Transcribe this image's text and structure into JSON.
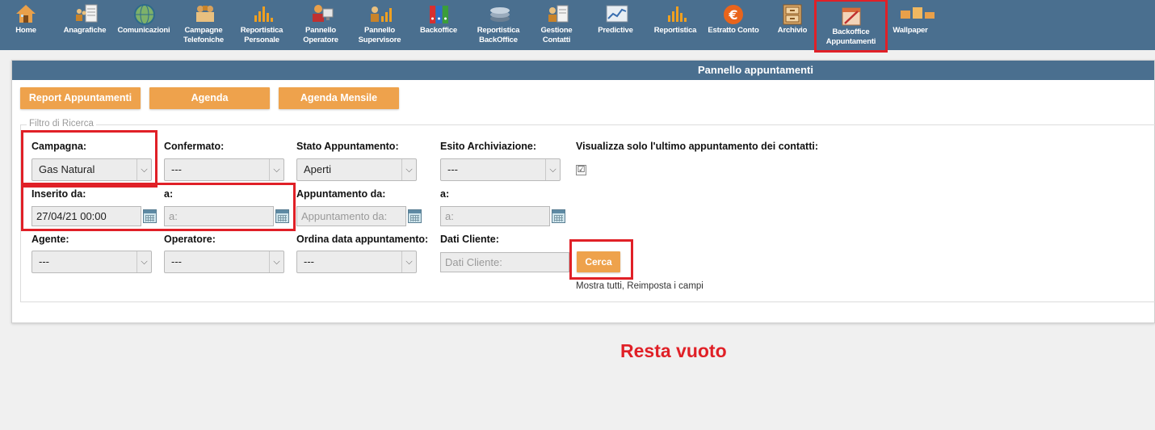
{
  "toolbar": {
    "items": [
      {
        "label": "Home",
        "icon": "home-icon"
      },
      {
        "label": "Anagrafiche",
        "icon": "people-document-icon"
      },
      {
        "label": "Comunicazioni",
        "icon": "globe-icon"
      },
      {
        "label": "Campagne\nTelefoniche",
        "icon": "campaign-icon"
      },
      {
        "label": "Reportistica\nPersonale",
        "icon": "bar-chart-icon"
      },
      {
        "label": "Pannello\nOperatore",
        "icon": "operator-icon"
      },
      {
        "label": "Pannello\nSupervisore",
        "icon": "supervisor-chart-icon"
      },
      {
        "label": "Backoffice",
        "icon": "binders-icon"
      },
      {
        "label": "Reportistica\nBackOffice",
        "icon": "stack-icon"
      },
      {
        "label": "Gestione\nContatti",
        "icon": "contacts-icon"
      },
      {
        "label": "Predictive",
        "icon": "line-chart-icon"
      },
      {
        "label": "Reportistica",
        "icon": "bar-chart-icon"
      },
      {
        "label": "Estratto Conto",
        "icon": "euro-icon"
      },
      {
        "label": "Archivio",
        "icon": "cabinet-icon"
      },
      {
        "label": "Backoffice\nAppuntamenti",
        "icon": "calendar-pencil-icon"
      },
      {
        "label": "Wallpaper",
        "icon": "wallpaper-icon"
      }
    ]
  },
  "panel": {
    "title": "Pannello appuntamenti",
    "buttons": {
      "report": "Report Appuntamenti",
      "agenda": "Agenda",
      "agenda_mensile": "Agenda Mensile"
    },
    "legend": "Filtro di Ricerca"
  },
  "filters": {
    "campagna": {
      "label": "Campagna:",
      "value": "Gas Natural"
    },
    "confermato": {
      "label": "Confermato:",
      "value": "---"
    },
    "stato": {
      "label": "Stato Appuntamento:",
      "value": "Aperti"
    },
    "esito": {
      "label": "Esito Archiviazione:",
      "value": "---"
    },
    "visualizza": {
      "label": "Visualizza solo l'ultimo appuntamento dei contatti:",
      "checked": "☑"
    },
    "inserito_da": {
      "label": "Inserito da:",
      "value": "27/04/21 00:00"
    },
    "inserito_a": {
      "label": "a:",
      "placeholder": "a:"
    },
    "app_da": {
      "label": "Appuntamento da:",
      "placeholder": "Appuntamento da:"
    },
    "app_a": {
      "label": "a:",
      "placeholder": "a:"
    },
    "agente": {
      "label": "Agente:",
      "value": "---"
    },
    "operatore": {
      "label": "Operatore:",
      "value": "---"
    },
    "ordina": {
      "label": "Ordina data appuntamento:",
      "value": "---"
    },
    "dati_cliente": {
      "label": "Dati Cliente:",
      "placeholder": "Dati Cliente:"
    },
    "cerca": "Cerca",
    "links": "Mostra tutti, Reimposta i campi"
  },
  "annotation": "Resta vuoto",
  "colors": {
    "toolbar_bg": "#4a6f8f",
    "accent_orange": "#eea24c",
    "highlight_red": "#e02027"
  }
}
